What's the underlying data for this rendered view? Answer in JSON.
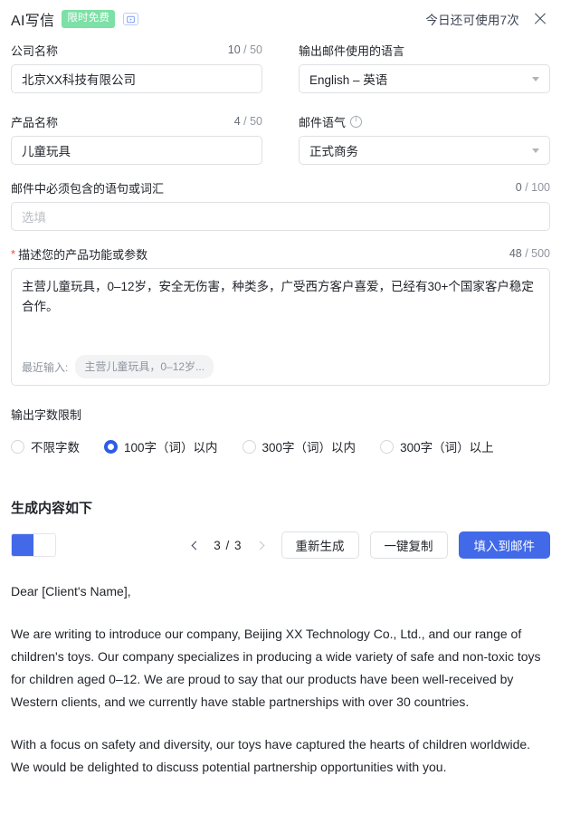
{
  "header": {
    "title": "AI写信",
    "badge": "限时免费",
    "video_icon": "video-play-icon",
    "quota": "今日还可使用7次",
    "close": "close-icon"
  },
  "form": {
    "company": {
      "label": "公司名称",
      "counter_current": "10",
      "counter_sep": " / ",
      "counter_max": "50",
      "value": "北京XX科技有限公司"
    },
    "language": {
      "label": "输出邮件使用的语言",
      "value": "English – 英语"
    },
    "product": {
      "label": "产品名称",
      "counter_current": "4",
      "counter_sep": " / ",
      "counter_max": "50",
      "value": "儿童玩具"
    },
    "tone": {
      "label": "邮件语气",
      "info": "info-icon",
      "value": "正式商务"
    },
    "keywords": {
      "label": "邮件中必须包含的语句或词汇",
      "counter_current": "0",
      "counter_sep": " / ",
      "counter_max": "100",
      "placeholder": "选填",
      "value": ""
    },
    "description": {
      "required_mark": "*",
      "label": "描述您的产品功能或参数",
      "counter_current": "48",
      "counter_sep": " / ",
      "counter_max": "500",
      "value": "主营儿童玩具，0–12岁，安全无伤害，种类多，广受西方客户喜爱，已经有30+个国家客户稳定合作。",
      "recent_label": "最近输入:",
      "recent_chip": "主营儿童玩具，0–12岁..."
    },
    "word_limit": {
      "label": "输出字数限制",
      "options": [
        {
          "label": "不限字数",
          "selected": false
        },
        {
          "label": "100字（词）以内",
          "selected": true
        },
        {
          "label": "300字（词）以内",
          "selected": false
        },
        {
          "label": "300字（词）以上",
          "selected": false
        }
      ]
    }
  },
  "result": {
    "title": "生成内容如下",
    "toggle_state": "left",
    "pager": {
      "prev": "chevron-left-icon",
      "next": "chevron-right-icon",
      "text": "3 / 3"
    },
    "buttons": {
      "regenerate": "重新生成",
      "copy": "一键复制",
      "fill": "填入到邮件"
    },
    "letter": [
      "Dear [Client's Name],",
      "We are writing to introduce our company, Beijing XX Technology Co., Ltd., and our range of children's toys. Our company specializes in producing a wide variety of safe and non-toxic toys for children aged 0–12. We are proud to say that our products have been well-received by Western clients, and we currently have stable partnerships with over 30 countries.",
      "With a focus on safety and diversity, our toys have captured the hearts of children worldwide. We would be delighted to discuss potential partnership opportunities with you."
    ]
  },
  "colors": {
    "accent": "#4169e8",
    "radio_accent": "#2c5ce6",
    "badge_bg": "#7de0a6",
    "required": "#f5483b"
  }
}
